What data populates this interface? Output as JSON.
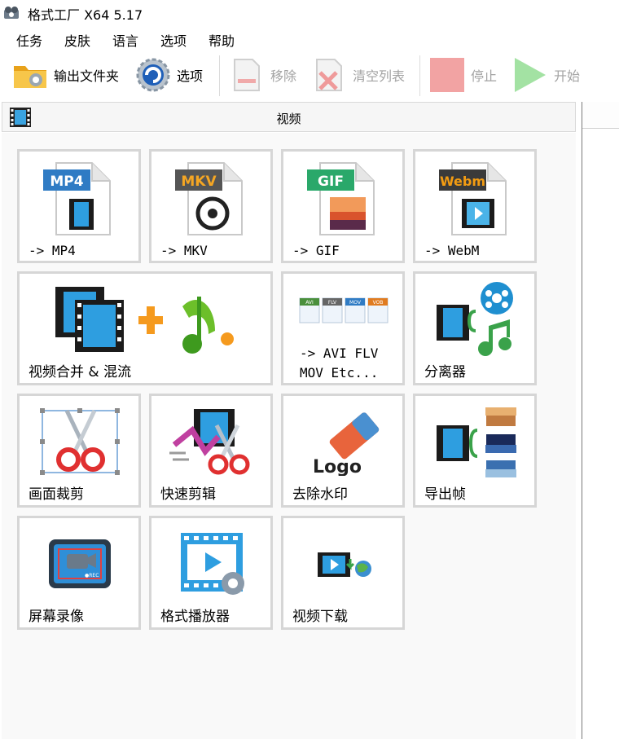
{
  "window": {
    "title": "格式工厂 X64 5.17"
  },
  "menu": [
    {
      "id": "task",
      "label": "任务"
    },
    {
      "id": "skin",
      "label": "皮肤"
    },
    {
      "id": "language",
      "label": "语言"
    },
    {
      "id": "options",
      "label": "选项"
    },
    {
      "id": "help",
      "label": "帮助"
    }
  ],
  "toolbar": {
    "output_folder": "输出文件夹",
    "options": "选项",
    "remove": "移除",
    "clear_list": "清空列表",
    "stop": "停止",
    "start": "开始"
  },
  "panel": {
    "title": "视频"
  },
  "tiles": {
    "mp4": {
      "label": "-> MP4",
      "badge": "MP4",
      "badge_color": "#2f7bc4"
    },
    "mkv": {
      "label": "-> MKV",
      "badge": "MKV",
      "badge_color": "#555555"
    },
    "gif": {
      "label": "-> GIF",
      "badge": "GIF",
      "badge_color": "#2aa86a"
    },
    "webm": {
      "label": "-> WebM",
      "badge": "Webm",
      "badge_color": "#f39c12"
    },
    "merge": {
      "label": "视频合并 & 混流"
    },
    "others": {
      "line1": "-> AVI FLV",
      "line2": "MOV Etc...",
      "icons": [
        "AVI",
        "FLV",
        "MOV",
        "VOB"
      ]
    },
    "demux": {
      "label": "分离器"
    },
    "crop": {
      "label": "画面裁剪"
    },
    "quick_clip": {
      "label": "快速剪辑"
    },
    "delogo": {
      "label": "去除水印",
      "logo_text": "Logo"
    },
    "export_frames": {
      "label": "导出帧"
    },
    "screen_record": {
      "label": "屏幕录像",
      "rec_text": "●REC"
    },
    "player": {
      "label": "格式播放器"
    },
    "download": {
      "label": "视频下载"
    }
  }
}
